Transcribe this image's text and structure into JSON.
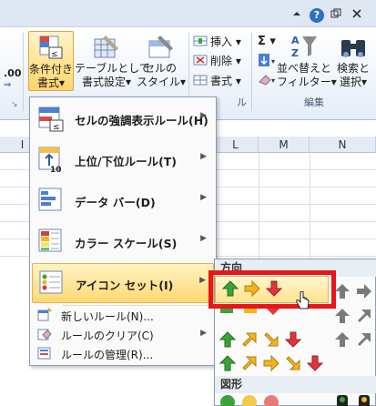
{
  "topbar": {
    "minimize_icon": "caret-up-icon",
    "help_label": "?",
    "restore_icon": "restore-window-icon",
    "close_icon": "close-icon"
  },
  "ribbon": {
    "number_format_partial": ".00",
    "conditional_format": {
      "line1": "条件付き",
      "line2": "書式▾"
    },
    "format_as_table": {
      "line1": "テーブルとして",
      "line2": "書式設定▾"
    },
    "cell_styles": {
      "line1": "セルの",
      "line2": "スタイル▾"
    },
    "insert_label": "挿入 ▾",
    "delete_label": "削除 ▾",
    "format_label": "書式 ▾",
    "cells_group_partial": "ル",
    "sum_label": "Σ ▾",
    "sort_filter": {
      "line1": "並べ替えと",
      "line2": "フィルター▾"
    },
    "find_select": {
      "line1": "検索と",
      "line2": "選択▾"
    },
    "editing_group": "編集"
  },
  "grid": {
    "columns": [
      "I",
      "L",
      "M",
      "N"
    ]
  },
  "menu": {
    "items": [
      {
        "label": "セルの強調表示ルール(H)",
        "has_submenu": true
      },
      {
        "label": "上位/下位ルール(T)",
        "has_submenu": true
      },
      {
        "label": "データ バー(D)",
        "has_submenu": true
      },
      {
        "label": "カラー スケール(S)",
        "has_submenu": true
      },
      {
        "label": "アイコン セット(I)",
        "has_submenu": true,
        "active": true
      }
    ],
    "small_items": [
      {
        "label": "新しいルール(N)..."
      },
      {
        "label": "ルールのクリア(C)",
        "has_submenu": true
      },
      {
        "label": "ルールの管理(R)..."
      }
    ]
  },
  "submenu": {
    "section_directional": "方向",
    "section_shapes": "図形",
    "highlighted_set": "3-arrows-colored"
  },
  "colors": {
    "highlight_border": "#e8151a",
    "arrow_green": "#3aa33a",
    "arrow_yellow": "#f2b51e",
    "arrow_red": "#e0353a",
    "arrow_gray": "#7a7a7a"
  }
}
